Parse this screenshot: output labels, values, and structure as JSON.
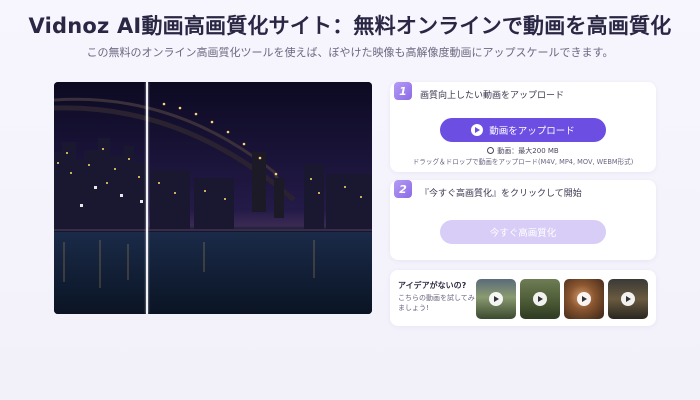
{
  "header": {
    "title": "Vidnoz AI動画高画質化サイト：無料オンラインで動画を高画質化",
    "subtitle": "この無料のオンライン高画質化ツールを使えば、ぼやけた映像も高解像度動画にアップスケールできます。"
  },
  "steps": [
    {
      "number": "1",
      "text": "画質向上したい動画をアップロード",
      "button_label": "動画をアップロード",
      "limit_text": "動画：最大200 MB",
      "formats_text": "ドラッグ＆ドロップで動画をアップロード(M4V, MP4, MOV, WEBM形式)"
    },
    {
      "number": "2",
      "text": "『今すぐ高画質化』をクリックして開始",
      "button_label": "今すぐ高画質化"
    }
  ],
  "ideas": {
    "title": "アイデアがないの?",
    "subtitle": "こちらの動画を試してみましょう!",
    "thumbnails": [
      "sample-video-1",
      "sample-video-2",
      "sample-video-3",
      "sample-video-4"
    ]
  },
  "colors": {
    "accent": "#6c4ee3",
    "accent_disabled": "#d8cdf7",
    "badge": "#8a6ae6"
  },
  "icons": {
    "upload_button": "play-circle-icon",
    "limit": "clock-icon",
    "thumbnail": "play-icon"
  }
}
